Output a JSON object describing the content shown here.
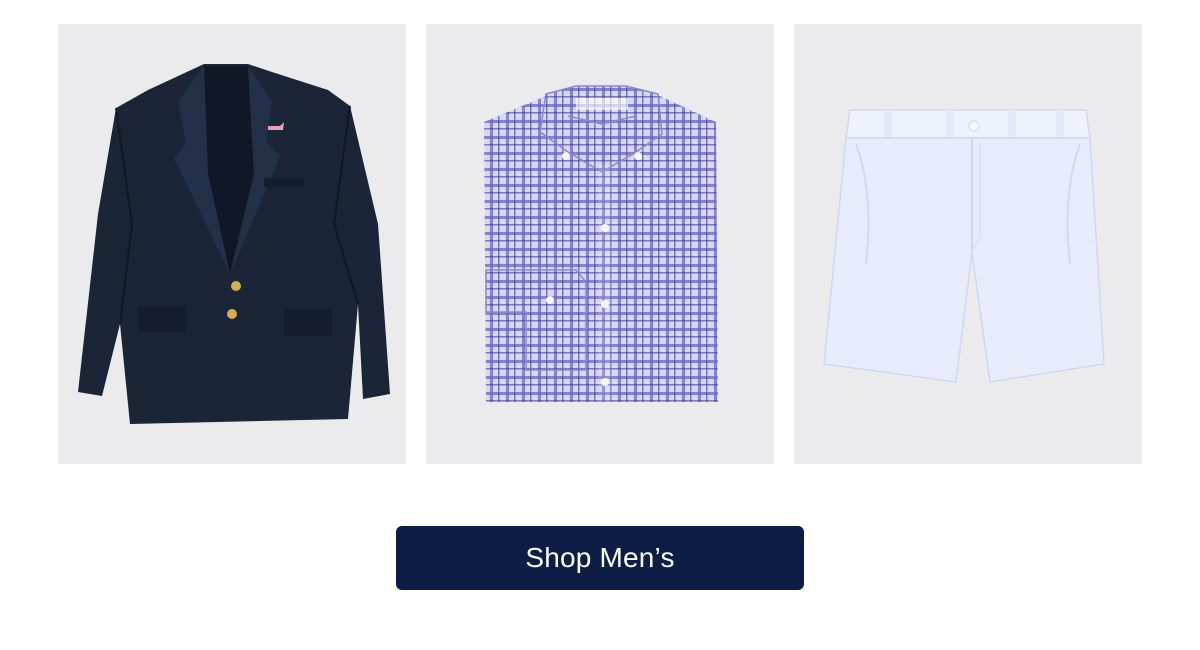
{
  "products": [
    {
      "name": "navy-blazer",
      "icon": "blazer-image"
    },
    {
      "name": "gingham-shirt",
      "icon": "dress-shirt-image"
    },
    {
      "name": "white-shorts",
      "icon": "shorts-image"
    }
  ],
  "cta": {
    "label": "Shop Men’s",
    "background": "#0c1e45",
    "text_color": "#ffffff"
  },
  "colors": {
    "tile_background": "#ebebed",
    "blazer": "#1a2537",
    "shirt_base": "#c8c9f2",
    "shirt_check": "#5a56b8",
    "shorts": "#e6ecfb"
  }
}
